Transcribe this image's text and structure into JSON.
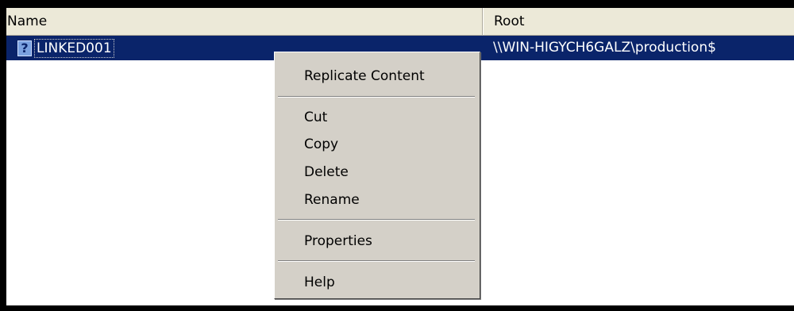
{
  "columns": {
    "name": "Name",
    "root": "Root"
  },
  "rows": [
    {
      "icon": "question-icon",
      "name": "LINKED001",
      "root": "\\\\WIN-HIGYCH6GALZ\\production$"
    }
  ],
  "context_menu": {
    "items": [
      "Replicate Content",
      "Cut",
      "Copy",
      "Delete",
      "Rename",
      "Properties",
      "Help"
    ]
  },
  "colors": {
    "selection": "#0a246a",
    "menu_bg": "#d4d0c8",
    "header_bg": "#ece9d8"
  }
}
